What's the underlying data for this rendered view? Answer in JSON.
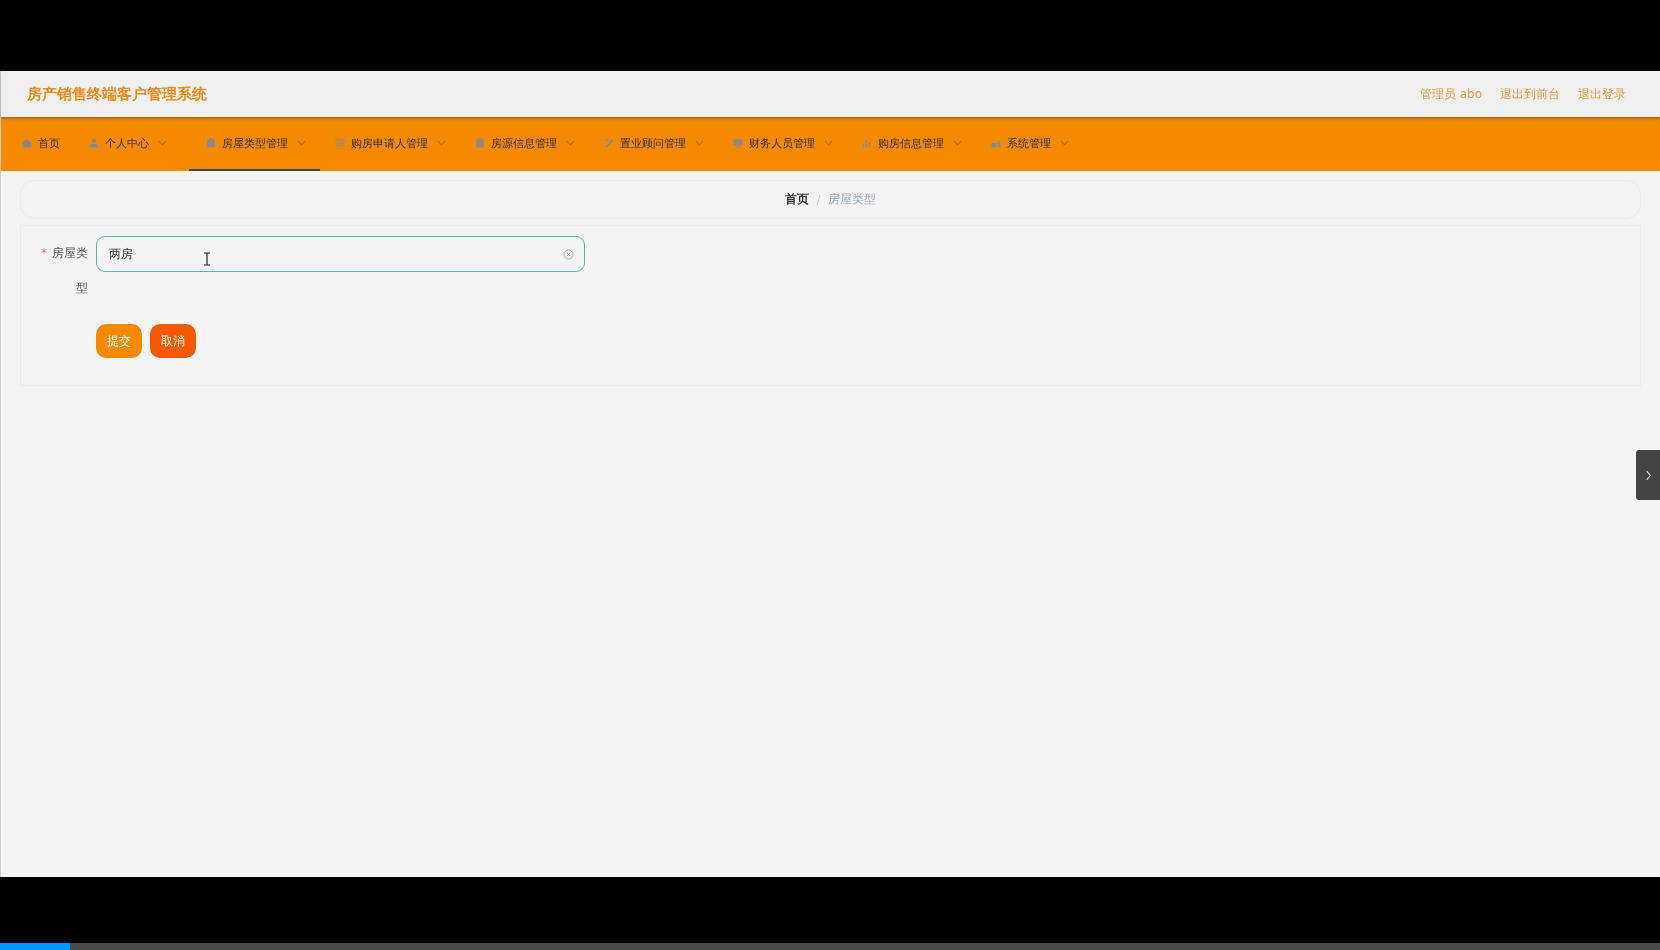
{
  "header": {
    "title": "房产销售终端客户管理系统",
    "user": "管理员 abo",
    "links": [
      "退出到前台",
      "退出登录"
    ]
  },
  "nav": [
    {
      "label": "首页",
      "dropdown": false,
      "selected": false
    },
    {
      "label": "个人中心",
      "dropdown": true,
      "selected": false
    },
    {
      "label": "房屋类型管理",
      "dropdown": true,
      "selected": true
    },
    {
      "label": "购房申请人管理",
      "dropdown": true,
      "selected": false
    },
    {
      "label": "房源信息管理",
      "dropdown": true,
      "selected": false
    },
    {
      "label": "置业顾问管理",
      "dropdown": true,
      "selected": false
    },
    {
      "label": "财务人员管理",
      "dropdown": true,
      "selected": false
    },
    {
      "label": "购房信息管理",
      "dropdown": true,
      "selected": false
    },
    {
      "label": "系统管理",
      "dropdown": true,
      "selected": false
    }
  ],
  "breadcrumb": {
    "separator": "/",
    "items": [
      "首页",
      "房屋类型"
    ]
  },
  "form": {
    "fields": [
      {
        "label": "房屋类型",
        "required_mark": "*",
        "value": "两房"
      }
    ],
    "buttons": [
      {
        "label": "提交",
        "kind": "primary"
      },
      {
        "label": "取消",
        "kind": "danger"
      }
    ]
  },
  "video_progress": {
    "level": 0.042
  }
}
